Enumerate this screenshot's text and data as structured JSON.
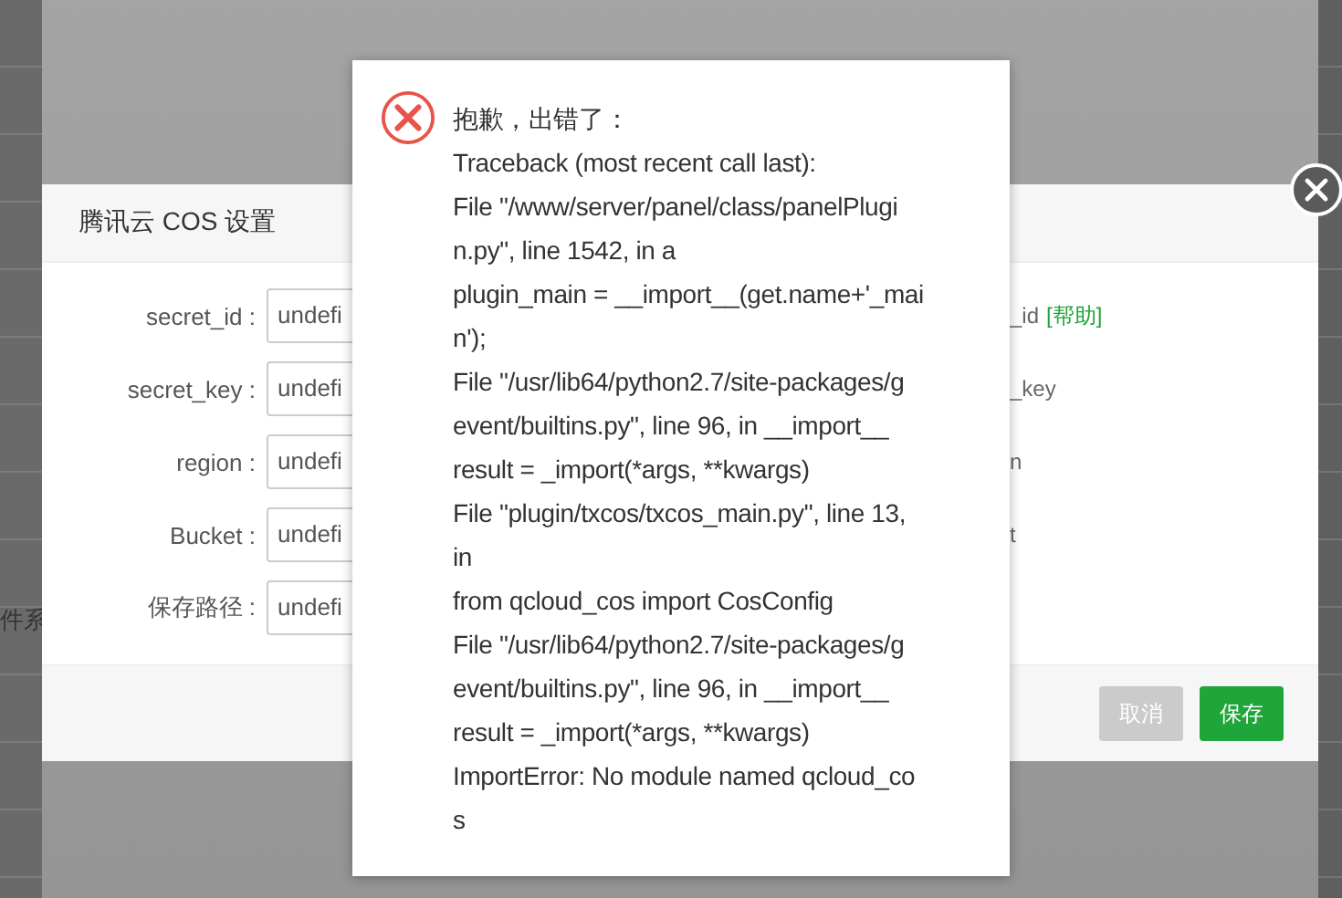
{
  "background": {
    "text": "件系"
  },
  "dialog": {
    "title": "腾讯云 COS 设置",
    "fields": [
      {
        "label": "secret_id :",
        "value": "undefi",
        "help": "_id",
        "link": "[帮助]"
      },
      {
        "label": "secret_key :",
        "value": "undefi",
        "help": "_key"
      },
      {
        "label": "region :",
        "value": "undefi",
        "help": "n"
      },
      {
        "label": "Bucket :",
        "value": "undefi",
        "help": "t"
      },
      {
        "label": "保存路径 :",
        "value": "undefi"
      }
    ],
    "buttons": [
      {
        "label": "取消",
        "kind": "cancel"
      },
      {
        "label": "保存",
        "kind": "primary"
      }
    ]
  },
  "error": {
    "heading": "抱歉，出错了：",
    "lines": [
      "Traceback (most recent call last):",
      "File \"/www/server/panel/class/panelPlugi",
      "n.py\", line 1542, in a",
      "plugin_main = __import__(get.name+'_mai",
      "n');",
      "File \"/usr/lib64/python2.7/site-packages/g",
      "event/builtins.py\", line 96, in __import__",
      "result = _import(*args, **kwargs)",
      "File \"plugin/txcos/txcos_main.py\", line 13,",
      "in",
      "from qcloud_cos import CosConfig",
      "File \"/usr/lib64/python2.7/site-packages/g",
      "event/builtins.py\", line 96, in __import__",
      "result = _import(*args, **kwargs)",
      "ImportError: No module named qcloud_co",
      "s"
    ]
  }
}
